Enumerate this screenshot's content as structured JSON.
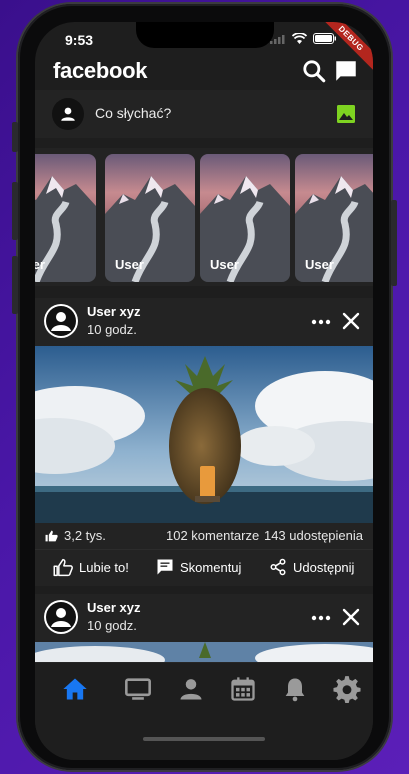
{
  "status_bar": {
    "time": "9:53"
  },
  "debug_banner": "DEBUG",
  "app_bar": {
    "title": "facebook",
    "icons": [
      "search-icon",
      "messenger-icon"
    ]
  },
  "composer": {
    "prompt": "Co słychać?",
    "icons": [
      "person-icon",
      "photo-icon"
    ]
  },
  "stories": [
    {
      "name": "User"
    },
    {
      "name": "User"
    },
    {
      "name": "User"
    },
    {
      "name": "User"
    }
  ],
  "posts": [
    {
      "user": "User xyz",
      "time": "10 godz.",
      "likes": "3,2 tys.",
      "comments": "102 komentarze",
      "shares": "143 udostępienia",
      "actions": {
        "like": "Lubie to!",
        "comment": "Skomentuj",
        "share": "Udostępnij"
      }
    },
    {
      "user": "User xyz",
      "time": "10 godz."
    }
  ],
  "bottom_nav": [
    "home-icon",
    "tv-icon",
    "profile-icon",
    "calendar-icon",
    "bell-icon",
    "settings-icon"
  ],
  "colors": {
    "background": "#1e1e1e",
    "surface": "#232323",
    "accent": "#1877f2",
    "photo_icon": "#7ed321",
    "debug": "#b3261e"
  }
}
